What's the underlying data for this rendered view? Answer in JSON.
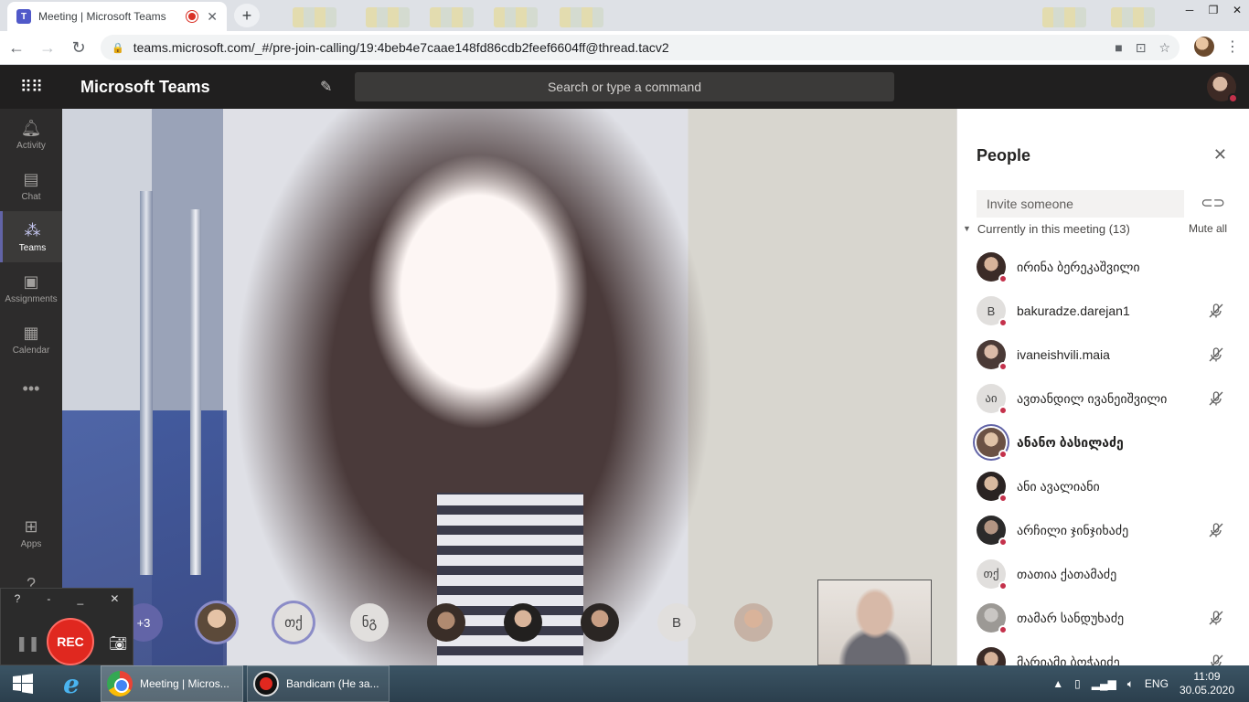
{
  "browser": {
    "tab_title": "Meeting | Microsoft Teams",
    "url": "teams.microsoft.com/_#/pre-join-calling/19:4beb4e7caae148fd86cdb2feef6604ff@thread.tacv2"
  },
  "teams": {
    "app_title": "Microsoft Teams",
    "search_placeholder": "Search or type a command",
    "rail": [
      {
        "label": "Activity",
        "icon": "bell-icon"
      },
      {
        "label": "Chat",
        "icon": "chat-icon"
      },
      {
        "label": "Teams",
        "icon": "teams-icon"
      },
      {
        "label": "Assignments",
        "icon": "assignments-icon"
      },
      {
        "label": "Calendar",
        "icon": "calendar-icon"
      },
      {
        "label": "Apps",
        "icon": "apps-icon"
      }
    ]
  },
  "stage": {
    "overflow_count": "+3",
    "participants": [
      "",
      "თქ",
      "ნგ",
      "",
      "",
      "",
      "B",
      ""
    ]
  },
  "recorder": {
    "rec_label": "REC",
    "help": "?"
  },
  "people": {
    "title": "People",
    "invite_placeholder": "Invite someone",
    "section": "Currently in this meeting (13)",
    "mute_all": "Mute all",
    "list": [
      {
        "name": "ირინა ბერეკაშვილი",
        "initials": "",
        "muted": false
      },
      {
        "name": "bakuradze.darejan1",
        "initials": "B",
        "muted": true
      },
      {
        "name": "ivaneishvili.maia",
        "initials": "",
        "muted": true
      },
      {
        "name": "ავთანდილ ივანეიშვილი",
        "initials": "აი",
        "muted": true
      },
      {
        "name": "ანანო ბასილაძე",
        "initials": "",
        "muted": false
      },
      {
        "name": "ანი ავალიანი",
        "initials": "",
        "muted": false
      },
      {
        "name": "არჩილი ჯინჯიხაძე",
        "initials": "",
        "muted": true
      },
      {
        "name": "თათია ქათამაძე",
        "initials": "თქ",
        "muted": false
      },
      {
        "name": "თამარ სანდუხაძე",
        "initials": "",
        "muted": true
      },
      {
        "name": "მარიამი ბოჭაიძე",
        "initials": "",
        "muted": true
      }
    ]
  },
  "taskbar": {
    "chrome_window": "Meeting | Micros...",
    "bandicam_window": "Bandicam (Не за...",
    "language": "ENG",
    "time": "11:09",
    "date": "30.05.2020"
  },
  "colors": {
    "accent": "#6264a7",
    "presence_busy": "#c4314b",
    "rec_red": "#e0281f"
  }
}
